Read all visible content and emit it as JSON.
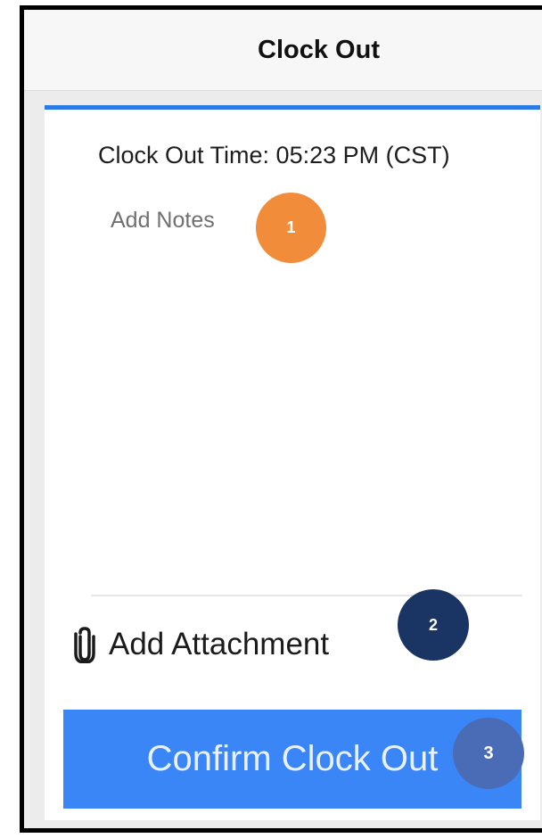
{
  "header": {
    "title": "Clock Out"
  },
  "form": {
    "clock_out_time": "Clock Out Time: 05:23 PM (CST)",
    "notes_placeholder": "Add Notes",
    "attachment_label": "Add Attachment",
    "attachment_icon": "paperclip-icon",
    "confirm_label": "Confirm Clock Out"
  },
  "callouts": [
    {
      "number": "1",
      "color": "#f08c3a"
    },
    {
      "number": "2",
      "color": "#1a3463"
    },
    {
      "number": "3",
      "color": "#4a6bb5"
    }
  ],
  "colors": {
    "accent": "#2c7be5",
    "button": "#3b86f7",
    "header_bg": "#f7f7f7",
    "page_bg": "#ececec"
  }
}
